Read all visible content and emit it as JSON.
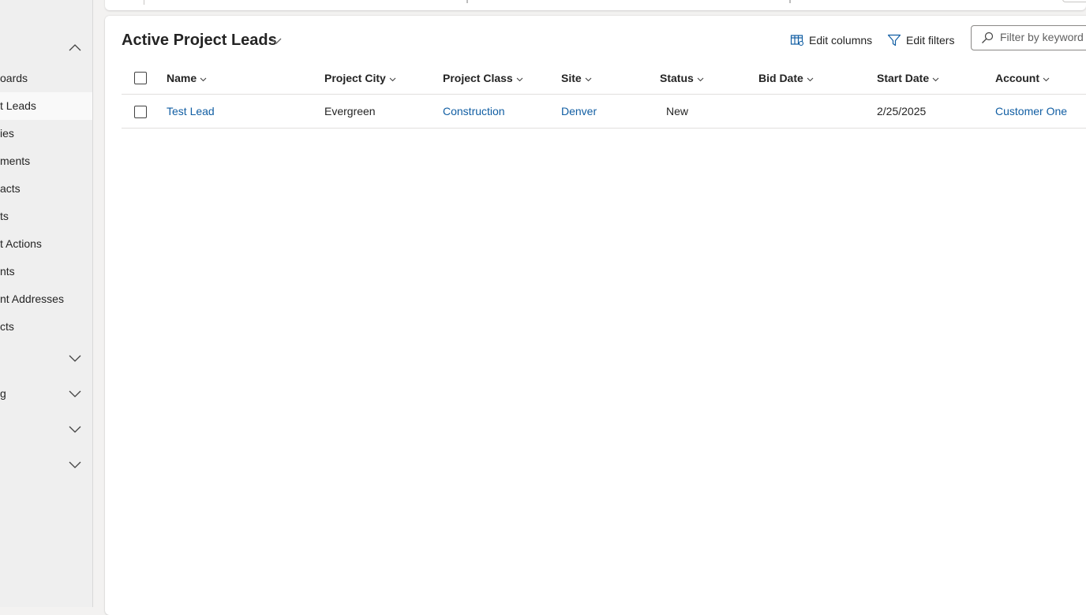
{
  "sidebar": {
    "items": [
      {
        "label": "oards"
      },
      {
        "label": "t Leads",
        "selected": true
      },
      {
        "label": "ies"
      },
      {
        "label": "ments"
      },
      {
        "label": "acts"
      },
      {
        "label": "ts"
      },
      {
        "label": "t Actions"
      },
      {
        "label": "nts"
      },
      {
        "label": "nt Addresses"
      },
      {
        "label": "cts"
      }
    ],
    "groups": [
      {
        "label": ""
      },
      {
        "label": "g"
      },
      {
        "label": ""
      },
      {
        "label": ""
      }
    ]
  },
  "view": {
    "title": "Active Project Leads"
  },
  "toolbar": {
    "edit_columns_label": "Edit columns",
    "edit_filters_label": "Edit filters",
    "search_placeholder": "Filter by keyword"
  },
  "grid": {
    "columns": [
      "Name",
      "Project City",
      "Project Class",
      "Site",
      "Status",
      "Bid Date",
      "Start Date",
      "Account"
    ],
    "rows": [
      {
        "name": "Test Lead",
        "project_city": "Evergreen",
        "project_class": "Construction",
        "site": "Denver",
        "status": "New",
        "bid_date": "",
        "start_date": "2/25/2025",
        "account": "Customer One"
      }
    ]
  },
  "colors": {
    "link": "#115ea3",
    "sidebar_bg": "#efefef",
    "page_bg": "#f3f2f1",
    "panel_bg": "#ffffff"
  }
}
